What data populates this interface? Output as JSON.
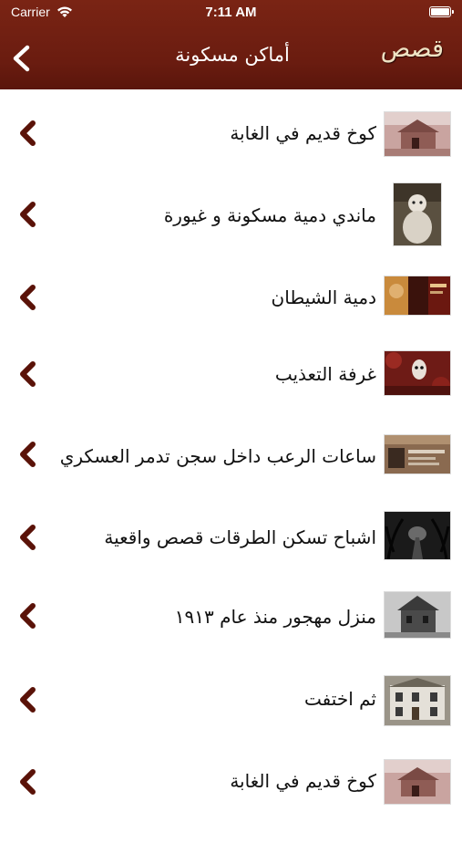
{
  "status_bar": {
    "carrier": "Carrier",
    "time": "7:11 AM"
  },
  "nav": {
    "title": "أماكن مسكونة",
    "logo": "قصص"
  },
  "colors": {
    "header": "#6a1c10",
    "chevron": "#5a1208",
    "logo": "#efe3c4"
  },
  "items": [
    {
      "label": "كوخ قديم في الغابة",
      "thumb": "cabin-thumbnail"
    },
    {
      "label": "ماندي دمية مسكونة و غيورة",
      "thumb": "doll-thumbnail"
    },
    {
      "label": "دمية الشيطان",
      "thumb": "movie-poster-thumbnail"
    },
    {
      "label": "غرفة التعذيب",
      "thumb": "mask-thumbnail"
    },
    {
      "label": "ساعات الرعب داخل سجن تدمر العسكري",
      "thumb": "prison-thumbnail"
    },
    {
      "label": "اشباح تسكن الطرقات قصص واقعية",
      "thumb": "dark-road-thumbnail"
    },
    {
      "label": "منزل مهجور منذ عام ١٩١٣",
      "thumb": "abandoned-house-thumbnail"
    },
    {
      "label": "ثم اختفت",
      "thumb": "white-house-thumbnail"
    },
    {
      "label": "كوخ قديم في الغابة",
      "thumb": "cabin-thumbnail"
    }
  ]
}
